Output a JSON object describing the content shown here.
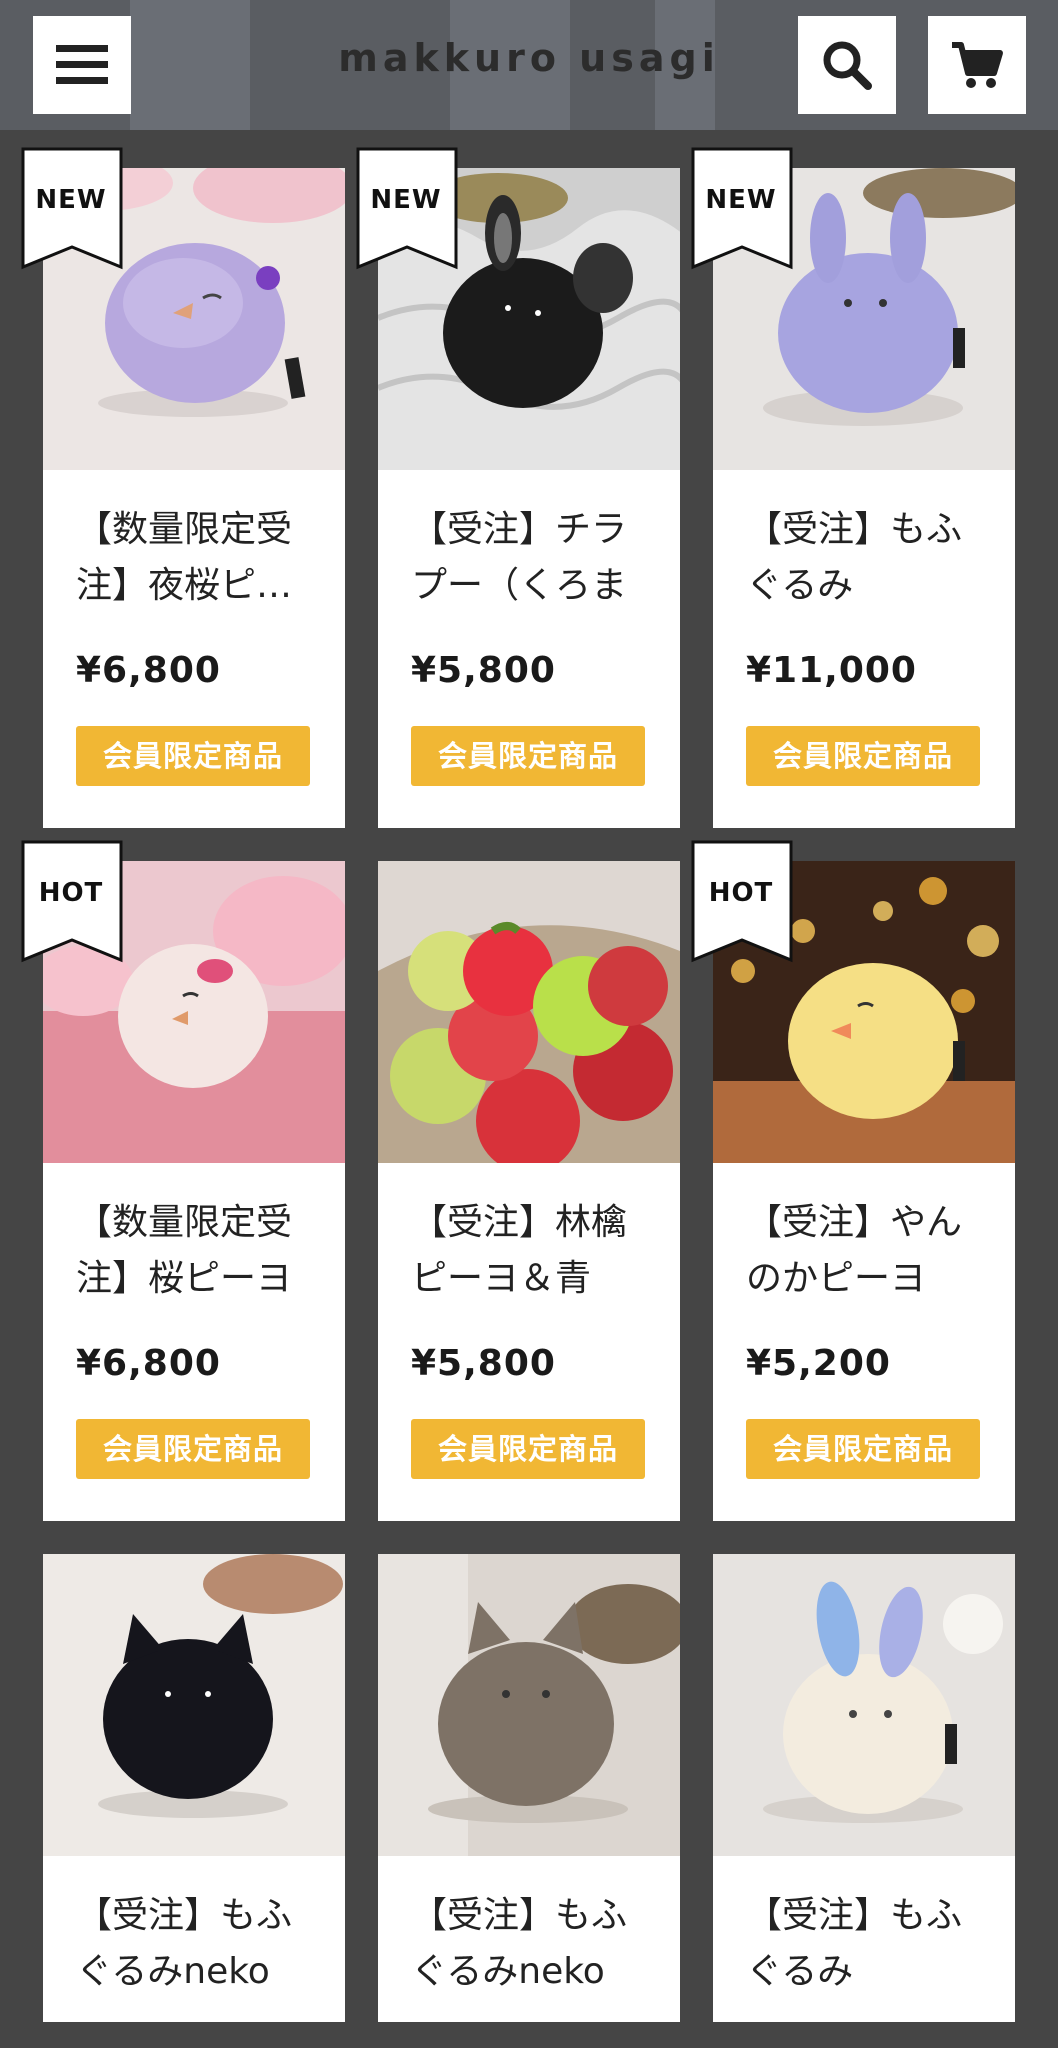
{
  "header": {
    "menu_icon": "hamburger-menu-icon",
    "logo": "makkuro usagi",
    "search_icon": "search-icon",
    "cart_icon": "cart-icon"
  },
  "products": [
    {
      "badge": "NEW",
      "title": "【数量限定受注】夜桜ピ…",
      "price": "¥6,800",
      "member": "会員限定商品",
      "image": "lavender bird plush on pink blossoms"
    },
    {
      "badge": "NEW",
      "title": "【受注】チラプー（くろまめ）",
      "price": "¥5,800",
      "member": "会員限定商品",
      "image": "black rabbit plush on white fur"
    },
    {
      "badge": "NEW",
      "title": "【受注】もふぐるみmeme…",
      "price": "¥11,000",
      "member": "会員限定商品",
      "image": "lavender bunny plush"
    },
    {
      "badge": "HOT",
      "title": "【数量限定受注】桜ピーヨ",
      "price": "¥6,800",
      "member": "会員限定商品",
      "image": "white bird plush with pink blossoms"
    },
    {
      "badge": "",
      "title": "【受注】林檎ピーヨ＆青林…",
      "price": "¥5,800",
      "member": "会員限定商品",
      "image": "apple bird plushes in basket"
    },
    {
      "badge": "HOT",
      "title": "【受注】やんのかピーヨ",
      "price": "¥5,200",
      "member": "会員限定商品",
      "image": "yellow bird plush with bokeh lights"
    },
    {
      "badge": "",
      "title": "【受注】もふぐるみnekoサ…",
      "price": "",
      "member": "",
      "image": "black cat plush"
    },
    {
      "badge": "",
      "title": "【受注】もふぐるみnekoサ…",
      "price": "",
      "member": "",
      "image": "gray cat plush"
    },
    {
      "badge": "",
      "title": "【受注】もふぐるみmeme…",
      "price": "",
      "member": "",
      "image": "cream bunny plush with blue ears"
    }
  ],
  "colors": {
    "background": "#454545",
    "header": "#5a5d62",
    "member_button": "#f1b734",
    "card": "#ffffff"
  }
}
